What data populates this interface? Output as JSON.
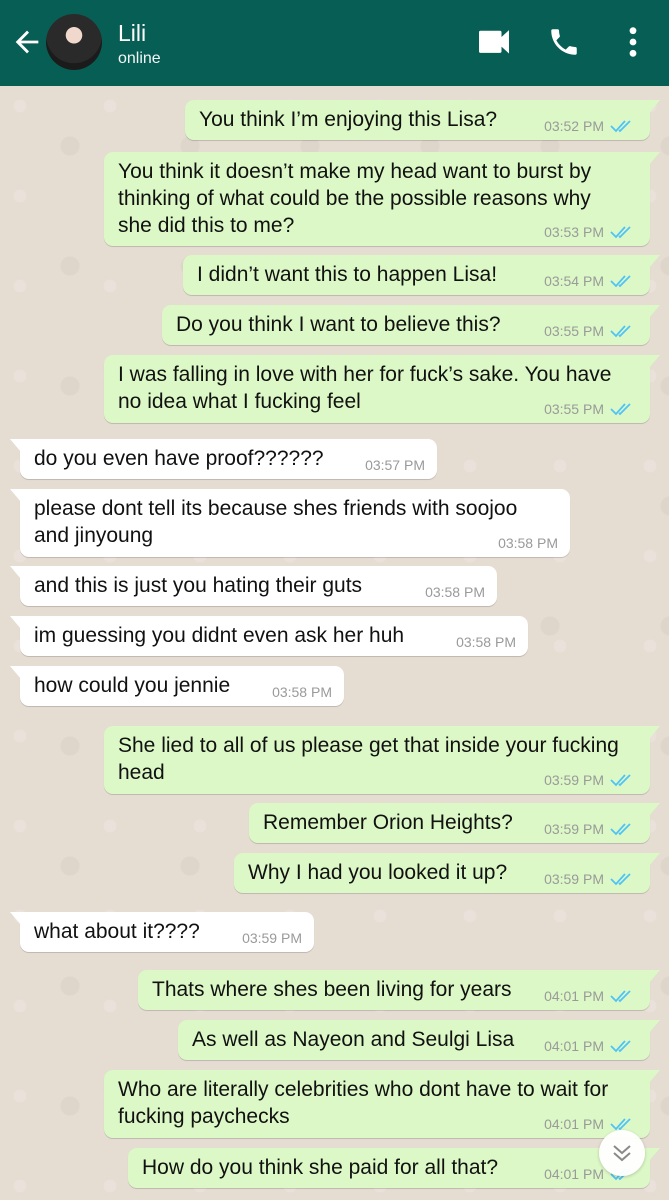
{
  "header": {
    "contact_name": "Lili",
    "contact_status": "online"
  },
  "icons": {
    "back": "arrow-left",
    "video": "video-camera",
    "call": "phone",
    "more": "three-dots-vertical",
    "scroll_down": "double-chevron-down",
    "read_ticks": "double-check-blue"
  },
  "colors": {
    "header": "#075e54",
    "outgoing_bubble": "#dcf8c6",
    "incoming_bubble": "#ffffff",
    "tick_blue": "#4fc3f7"
  },
  "messages": [
    {
      "dir": "out",
      "text": "You think I’m enjoying this Lisa?",
      "time": "03:52 PM"
    },
    {
      "dir": "out",
      "text": "You think it doesn’t make my head want to burst by thinking of what could be the possible reasons why she did this to me?",
      "time": "03:53 PM"
    },
    {
      "dir": "out",
      "text": "I didn’t want this to happen Lisa!",
      "time": "03:54 PM"
    },
    {
      "dir": "out",
      "text": "Do you think I want to believe this?",
      "time": "03:55 PM"
    },
    {
      "dir": "out",
      "text": "I was falling in love with her for fuck’s sake. You have no idea what I fucking feel",
      "time": "03:55 PM"
    },
    {
      "dir": "in",
      "text": "do you even have proof??????",
      "time": "03:57 PM"
    },
    {
      "dir": "in",
      "text": "please dont tell its because shes friends with soojoo and jinyoung",
      "time": "03:58 PM"
    },
    {
      "dir": "in",
      "text": "and this is just you hating their guts",
      "time": "03:58 PM"
    },
    {
      "dir": "in",
      "text": "im guessing you didnt even ask her huh",
      "time": "03:58 PM"
    },
    {
      "dir": "in",
      "text": "how could you jennie",
      "time": "03:58 PM"
    },
    {
      "dir": "out",
      "text": "She lied to all of us please get that inside your fucking head",
      "time": "03:59 PM"
    },
    {
      "dir": "out",
      "text": "Remember Orion Heights?",
      "time": "03:59 PM"
    },
    {
      "dir": "out",
      "text": "Why I had you looked it up?",
      "time": "03:59 PM"
    },
    {
      "dir": "in",
      "text": "what about it????",
      "time": "03:59 PM"
    },
    {
      "dir": "out",
      "text": "Thats where shes been living for years",
      "time": "04:01 PM"
    },
    {
      "dir": "out",
      "text": "As well as Nayeon and Seulgi Lisa",
      "time": "04:01 PM"
    },
    {
      "dir": "out",
      "text": "Who are literally celebrities who dont have to wait for fucking paychecks",
      "time": "04:01 PM"
    },
    {
      "dir": "out",
      "text": "How do you think she paid for all that?",
      "time": "04:01 PM"
    }
  ]
}
